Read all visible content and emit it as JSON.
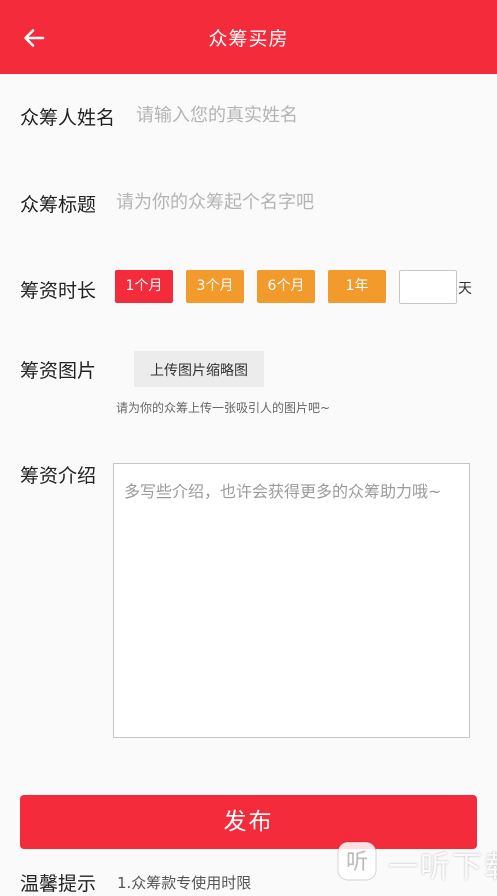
{
  "header": {
    "title": "众筹买房"
  },
  "form": {
    "name": {
      "label": "众筹人姓名",
      "placeholder": "请输入您的真实姓名",
      "value": ""
    },
    "title": {
      "label": "众筹标题",
      "placeholder": "请为你的众筹起个名字吧",
      "value": ""
    },
    "duration": {
      "label": "筹资时长",
      "options": [
        {
          "label": "1个月",
          "selected": true
        },
        {
          "label": "3个月",
          "selected": false
        },
        {
          "label": "6个月",
          "selected": false
        },
        {
          "label": "1年",
          "selected": false
        }
      ],
      "custom_unit": "天",
      "custom_value": ""
    },
    "image": {
      "label": "筹资图片",
      "button_label": "上传图片缩略图",
      "hint": "请为你的众筹上传一张吸引人的图片吧~"
    },
    "intro": {
      "label": "筹资介绍",
      "placeholder": "多写些介绍，也许会获得更多的众筹助力哦~",
      "value": ""
    }
  },
  "publish_label": "发布",
  "tip": {
    "label": "温馨提示",
    "text": "1.众筹款专使用时限"
  },
  "watermark": {
    "text": "一听下载",
    "icon_glyph": "听"
  },
  "colors": {
    "primary": "#f32b3b",
    "accent": "#f29a2c"
  },
  "icons": {
    "back": "arrow-left-icon",
    "watermark": "logo-icon"
  }
}
